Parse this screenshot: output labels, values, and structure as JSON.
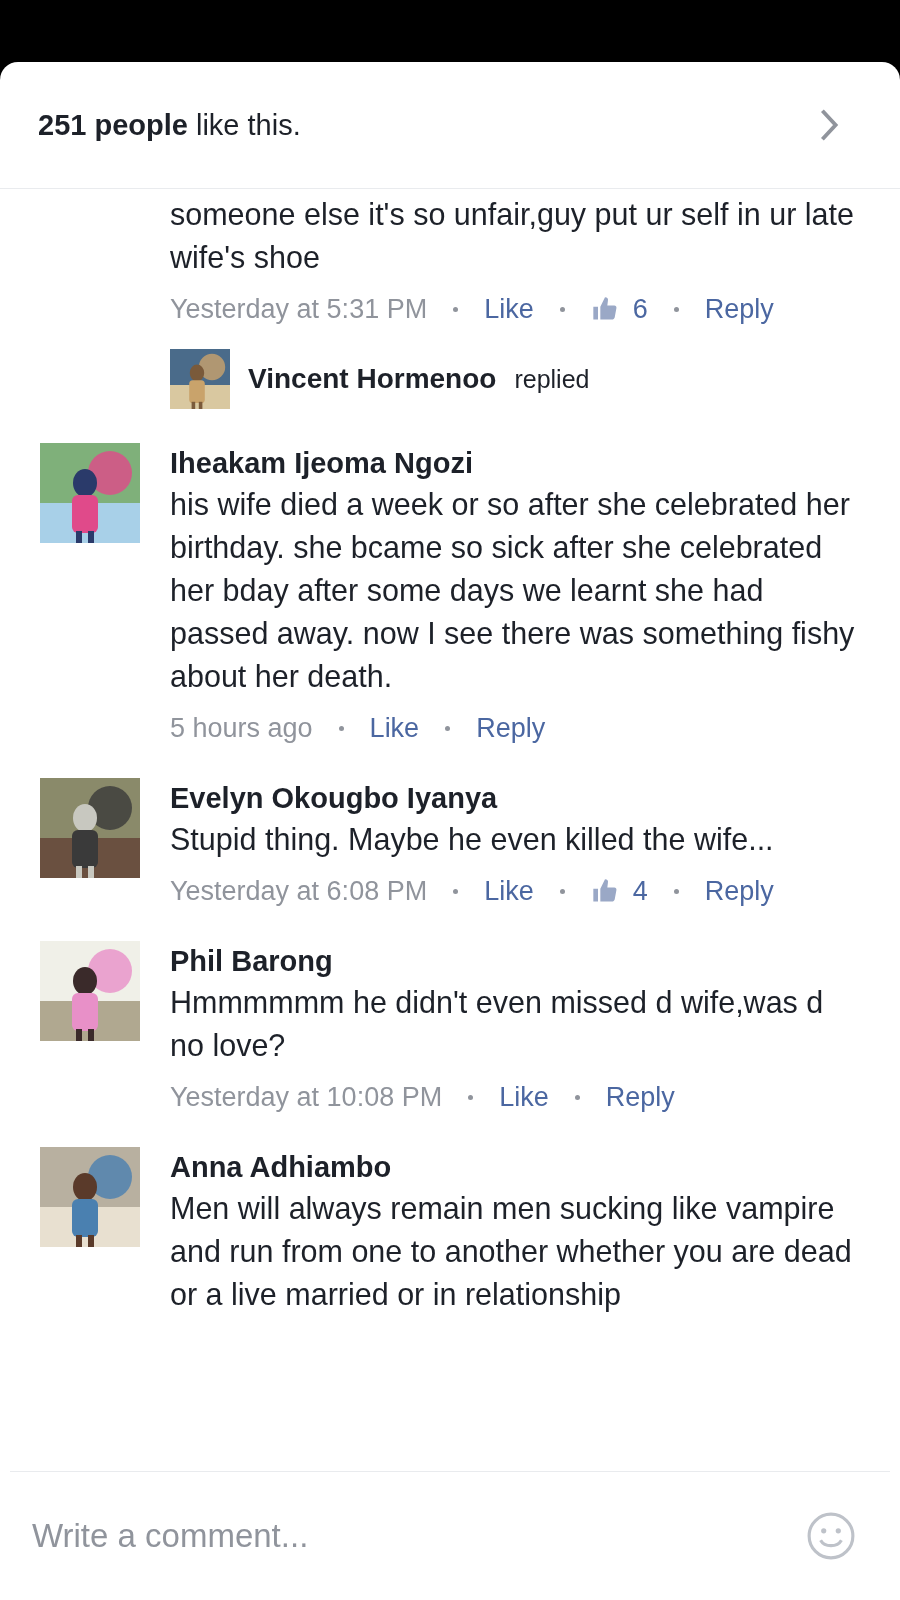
{
  "header": {
    "text": "**251 people** like this."
  },
  "comments": [
    {
      "kind": "continued",
      "text": "someone else it's so unfair,guy put ur self in ur late wife's shoe",
      "time": "Yesterday at 5:31 PM",
      "like": "Like",
      "like_count": "6",
      "reply": "Reply"
    },
    {
      "kind": "replies",
      "name": "Vincent Hormenoo",
      "text": "replied"
    },
    {
      "kind": "comment",
      "name": "Iheakam Ijeoma Ngozi",
      "text": "his wife died a week or so after she celebrated her birthday. she bcame so sick after she celebrated her bday after some days we learnt she had passed away. now I see there was something fishy about her death.",
      "time": "5 hours ago",
      "like": "Like",
      "reply": "Reply"
    },
    {
      "kind": "comment",
      "name": "Evelyn Okougbo Iyanya",
      "text": "Stupid thing. Maybe he even killed the wife...",
      "time": "Yesterday at 6:08 PM",
      "like": "Like",
      "like_count": "4",
      "reply": "Reply"
    },
    {
      "kind": "comment",
      "name": "Phil Barong",
      "text": "Hmmmmmm he didn't even missed d wife,was d no love?",
      "time": "Yesterday at 10:08 PM",
      "like": "Like",
      "reply": "Reply"
    },
    {
      "kind": "comment",
      "name": "Anna Adhiambo",
      "text": "Men will always remain men sucking like vampire and run from one to another whether you are dead or a live  married  or in relationship"
    }
  ],
  "composer": {
    "placeholder": "Write a comment..."
  }
}
